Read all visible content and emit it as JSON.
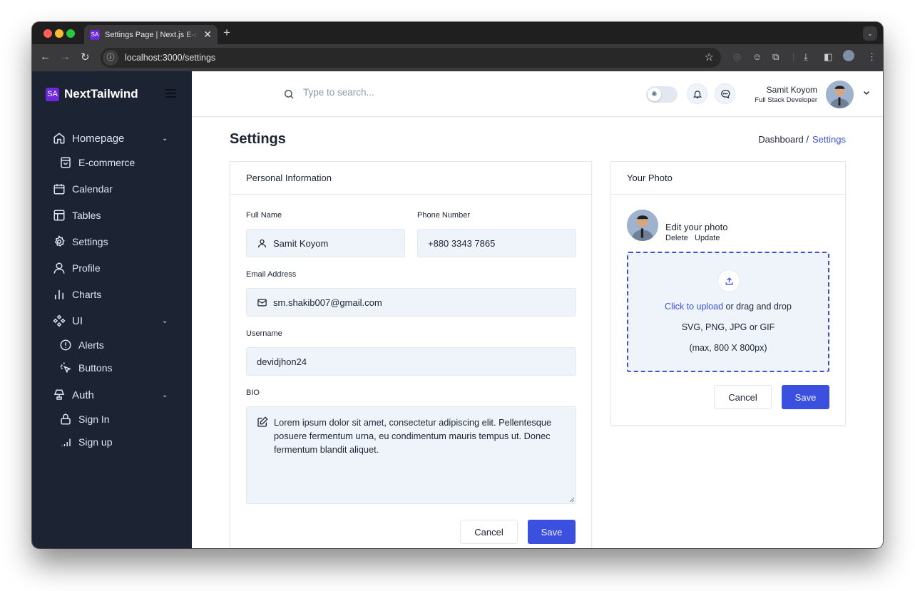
{
  "browser": {
    "tab_title": "Settings Page | Next.js E-commerce",
    "tab_favicon": "SA",
    "url": "localhost:3000/settings",
    "icons": [
      "back-icon",
      "forward-icon",
      "reload-icon",
      "info-icon",
      "star-icon",
      "extension-icon",
      "download-icon",
      "sidepanel-icon",
      "profile-icon",
      "menu-icon"
    ]
  },
  "sidebar": {
    "logo_text": "SA",
    "brand": "NextTailwind",
    "items": [
      {
        "label": "Homepage",
        "icon": "home-icon",
        "expandable": true
      },
      {
        "label": "E-commerce",
        "icon": "shopping-bag-icon",
        "sub": true
      },
      {
        "label": "Calendar",
        "icon": "calendar-icon"
      },
      {
        "label": "Tables",
        "icon": "table-icon"
      },
      {
        "label": "Settings",
        "icon": "gear-icon"
      },
      {
        "label": "Profile",
        "icon": "user-icon"
      },
      {
        "label": "Charts",
        "icon": "bar-chart-icon"
      },
      {
        "label": "UI",
        "icon": "components-icon",
        "expandable": true
      },
      {
        "label": "Alerts",
        "icon": "alert-circle-icon",
        "sub": true
      },
      {
        "label": "Buttons",
        "icon": "pointer-click-icon",
        "sub": true
      },
      {
        "label": "Auth",
        "icon": "lamp-icon",
        "expandable": true
      },
      {
        "label": "Sign In",
        "icon": "lock-icon",
        "sub": true
      },
      {
        "label": "Sign up",
        "icon": "signal-icon",
        "sub": true
      }
    ]
  },
  "header": {
    "search_placeholder": "Type to search...",
    "user_name": "Samit Koyom",
    "user_role": "Full Stack Developer"
  },
  "page": {
    "title": "Settings",
    "breadcrumb_home": "Dashboard /",
    "breadcrumb_current": "Settings"
  },
  "personal_info": {
    "heading": "Personal Information",
    "full_name_label": "Full Name",
    "full_name_value": "Samit Koyom",
    "phone_label": "Phone Number",
    "phone_value": "+880 3343 7865",
    "email_label": "Email Address",
    "email_value": "sm.shakib007@gmail.com",
    "username_label": "Username",
    "username_value": "devidjhon24",
    "bio_label": "BIO",
    "bio_value": "Lorem ipsum dolor sit amet, consectetur adipiscing elit. Pellentesque posuere fermentum urna, eu condimentum mauris tempus ut. Donec fermentum blandit aliquet.",
    "cancel": "Cancel",
    "save": "Save"
  },
  "photo": {
    "heading": "Your Photo",
    "edit_label": "Edit your photo",
    "delete": "Delete",
    "update": "Update",
    "upload_link": "Click to upload",
    "upload_rest": " or drag and drop",
    "formats": "SVG, PNG, JPG or GIF",
    "max_size": "(max, 800 X 800px)",
    "cancel": "Cancel",
    "save": "Save"
  },
  "colors": {
    "primary": "#3c50e0",
    "sidebar_bg": "#1c2434",
    "input_bg": "#eff4fb",
    "brand_logo": "#6d28d9"
  }
}
